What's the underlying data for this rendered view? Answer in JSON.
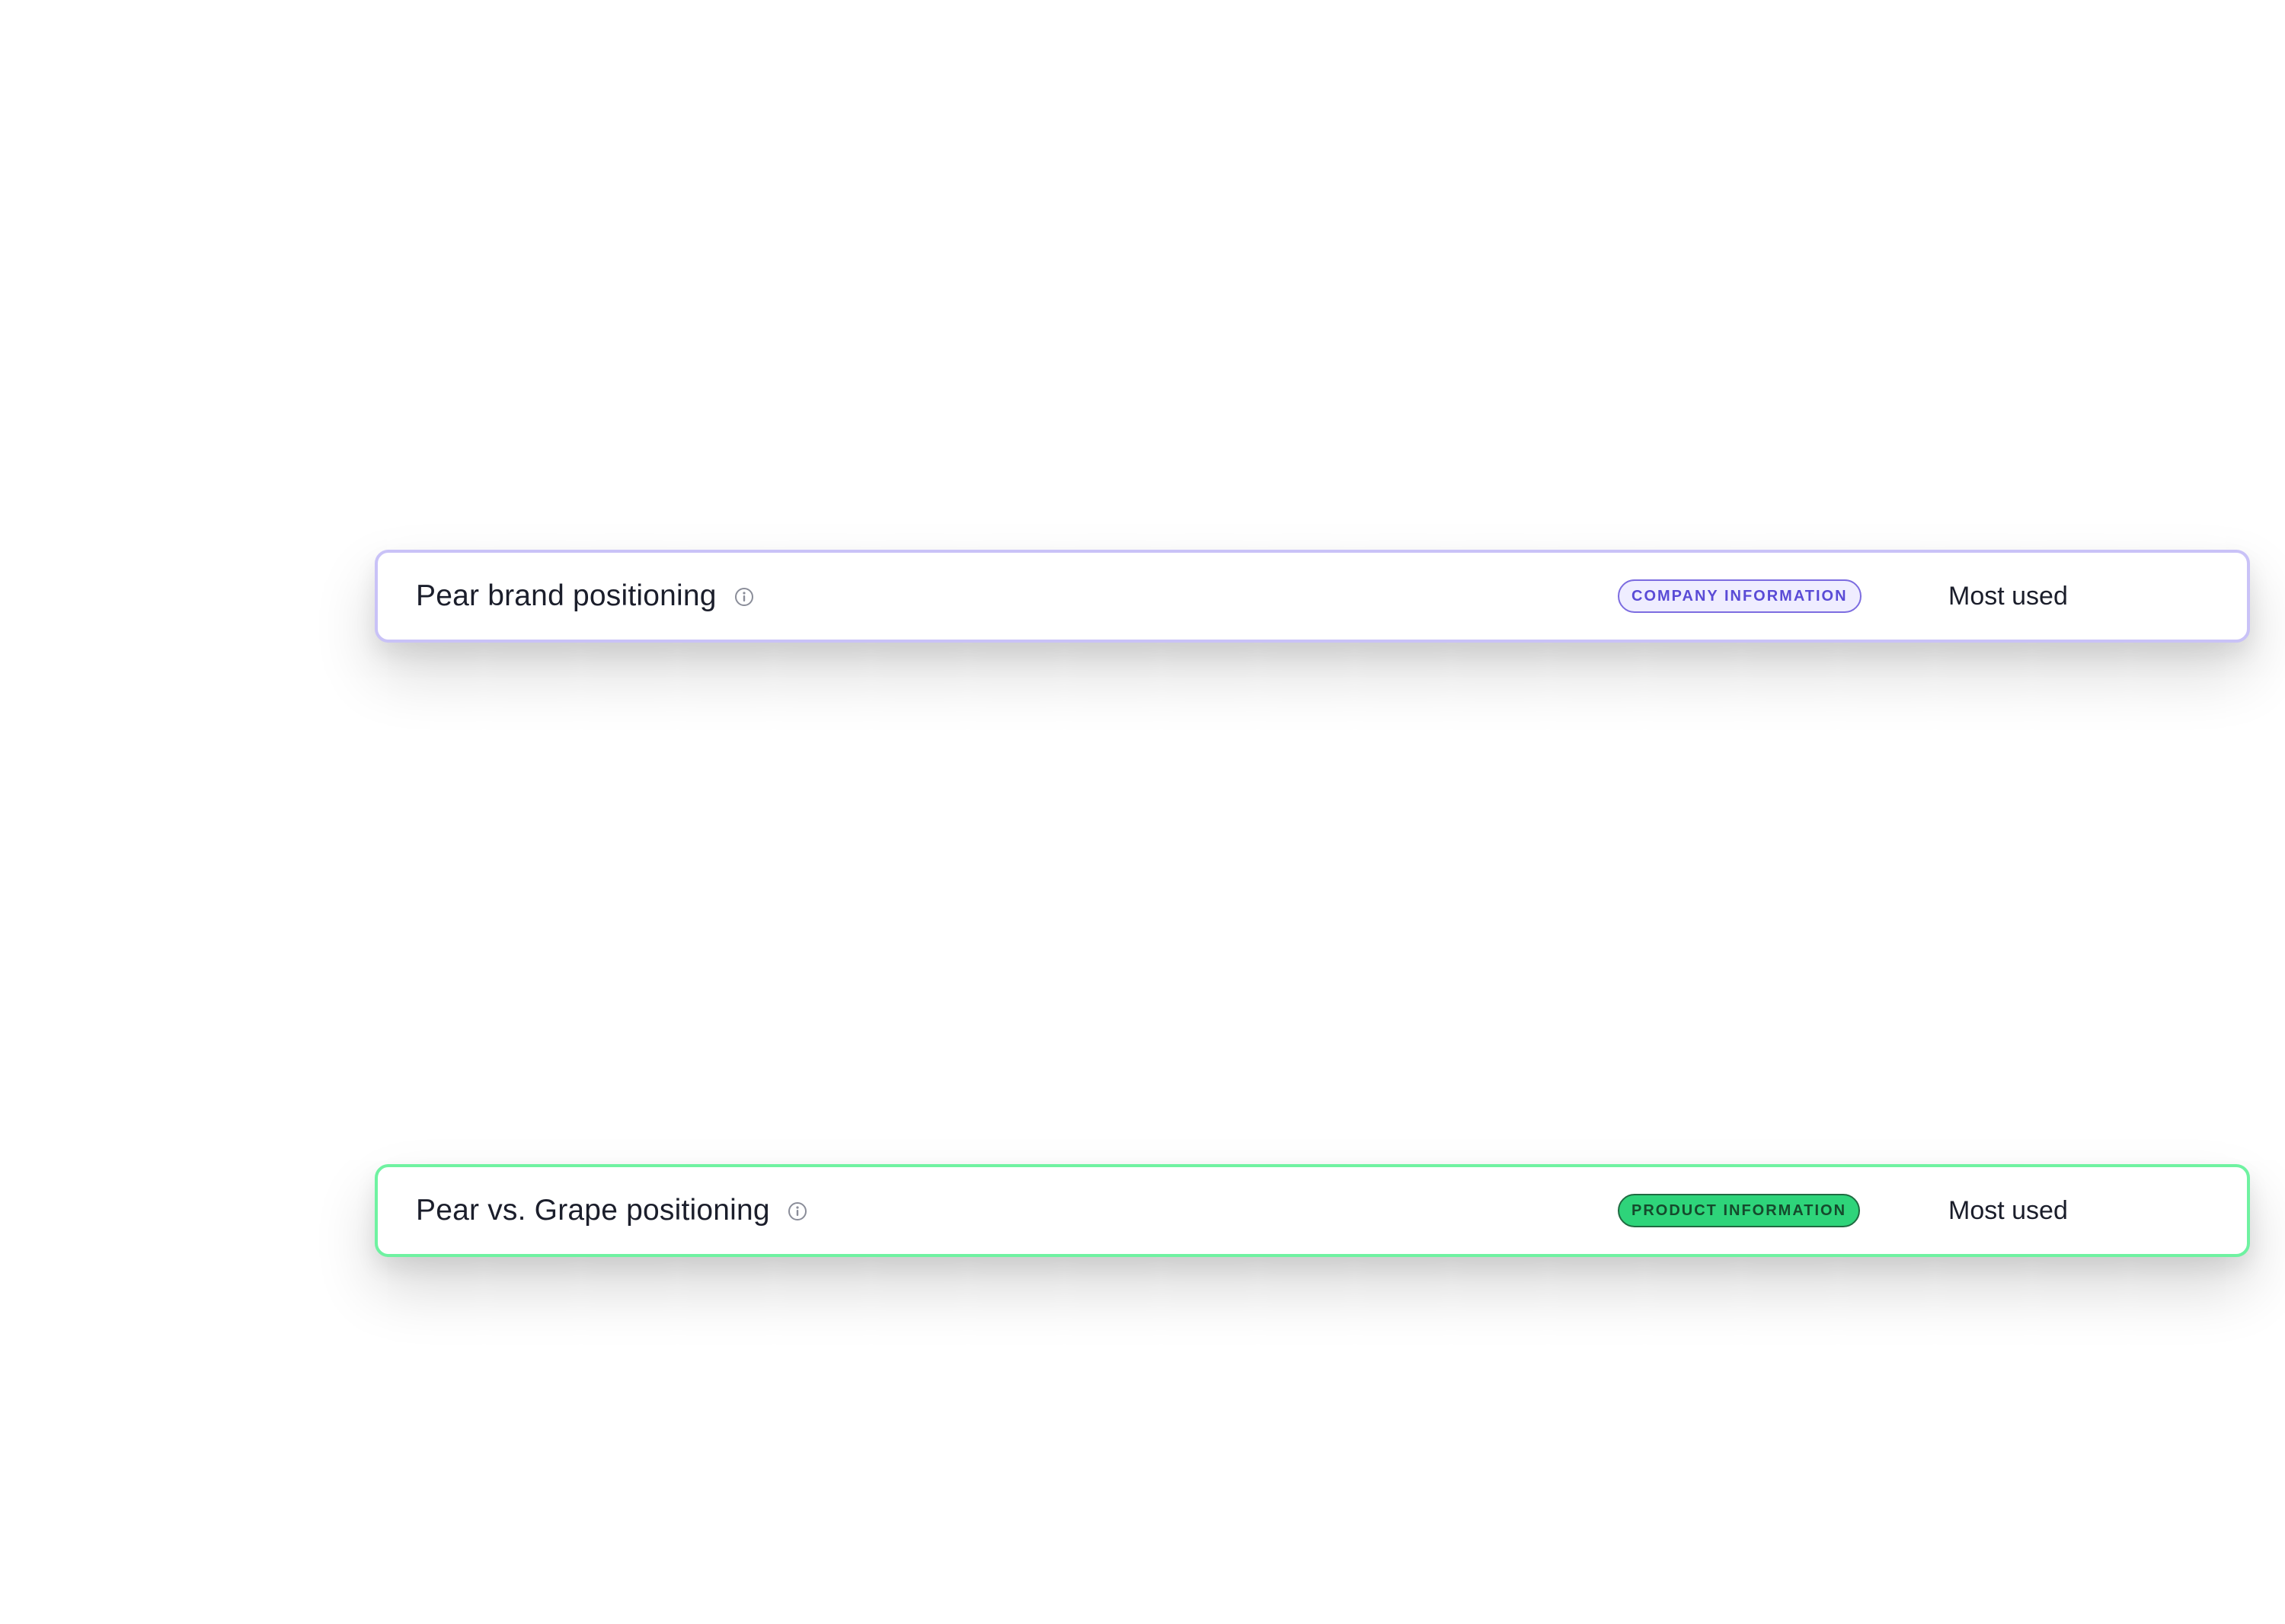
{
  "cards": [
    {
      "title": "Pear brand positioning",
      "info_icon": "info-circle-icon",
      "badge": "COMPANY INFORMATION",
      "badge_color": "#5a4bd6",
      "usage": "Most used",
      "border_color": "#c9c2f7"
    },
    {
      "title": "Pear vs. Grape positioning",
      "info_icon": "info-circle-icon",
      "badge": "PRODUCT INFORMATION",
      "badge_color": "#2ed47a",
      "usage": "Most used",
      "border_color": "#6ff2a1"
    }
  ]
}
